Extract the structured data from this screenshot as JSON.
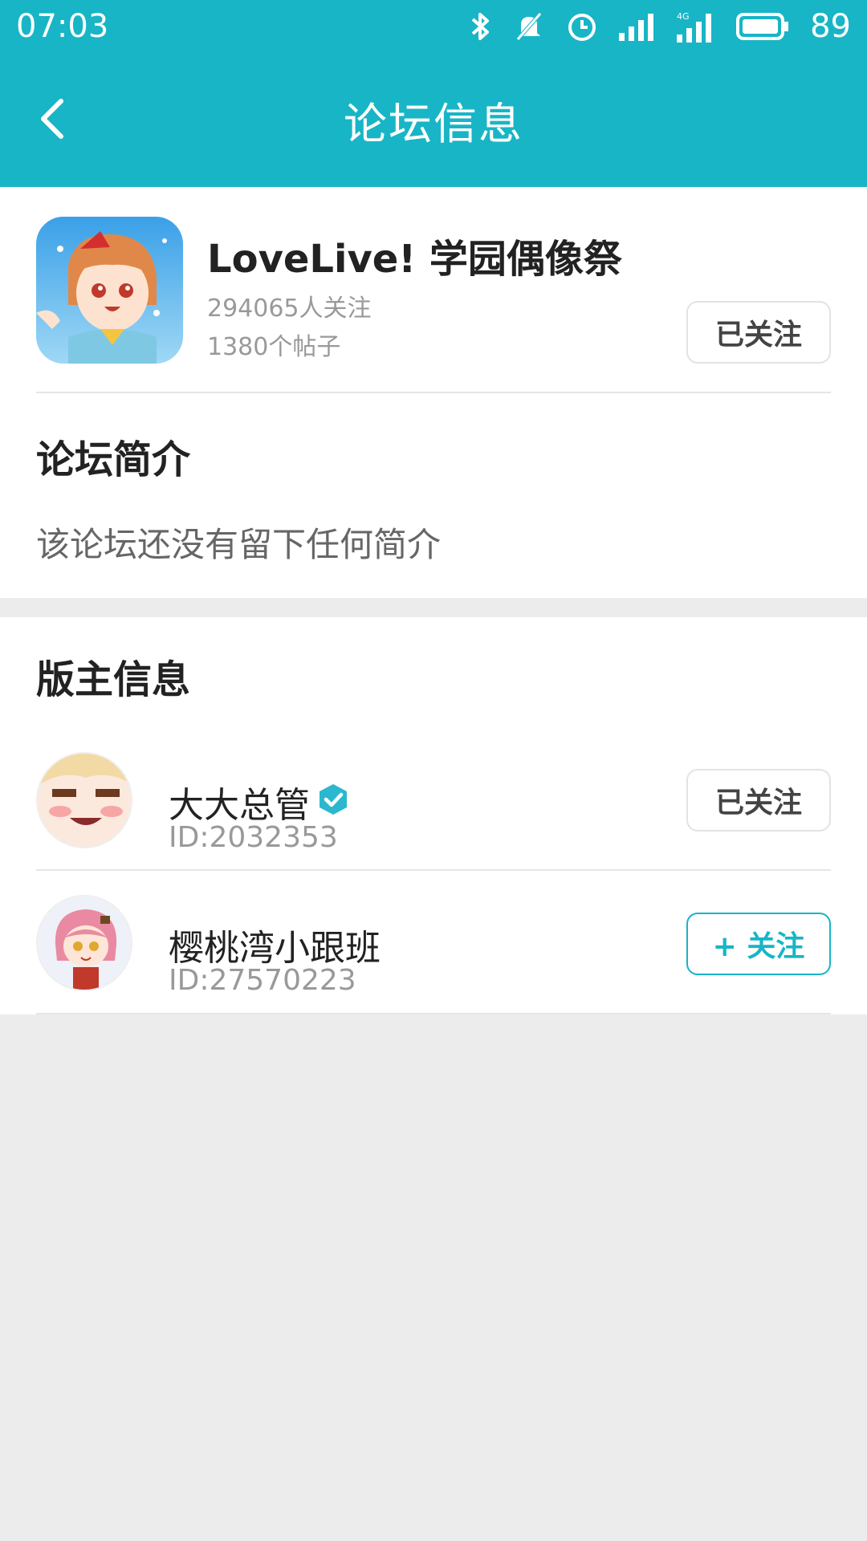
{
  "status_bar": {
    "time": "07:03",
    "battery": "89",
    "icons": [
      "bluetooth-icon",
      "mute-icon",
      "alarm-icon",
      "signal-icon",
      "4g-signal-icon",
      "battery-icon"
    ]
  },
  "header": {
    "title": "论坛信息",
    "back_icon": "back-arrow-icon"
  },
  "forum": {
    "name": "LoveLive! 学园偶像祭",
    "followers": "294065人关注",
    "posts": "1380个帖子",
    "follow_button": "已关注"
  },
  "intro": {
    "title": "论坛简介",
    "text": "该论坛还没有留下任何简介"
  },
  "moderators": {
    "title": "版主信息",
    "items": [
      {
        "name": "大大总管",
        "id": "ID:2032353",
        "button": "已关注",
        "verified": true
      },
      {
        "name": "樱桃湾小跟班",
        "id": "ID:27570223",
        "button": "+ 关注",
        "verified": false
      }
    ]
  },
  "colors": {
    "accent": "#18b5c6",
    "background": "#ececec"
  }
}
